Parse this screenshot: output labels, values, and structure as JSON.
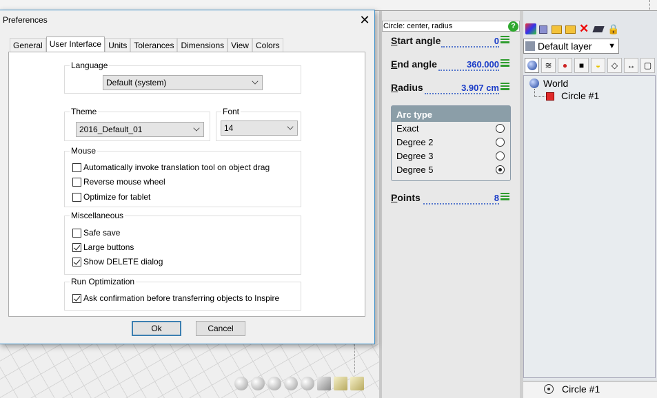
{
  "dialog": {
    "title": "Preferences",
    "tabs": [
      "General",
      "User Interface",
      "Units",
      "Tolerances",
      "Dimensions",
      "View",
      "Colors"
    ],
    "language": {
      "label": "Language",
      "value": "Default (system)"
    },
    "theme": {
      "label": "Theme",
      "value": "2016_Default_01"
    },
    "font": {
      "label": "Font",
      "value": "14"
    },
    "mouse": {
      "label": "Mouse",
      "options": [
        {
          "label": "Automatically invoke translation tool on object drag",
          "checked": false
        },
        {
          "label": "Reverse mouse wheel",
          "checked": false
        },
        {
          "label": "Optimize for tablet",
          "checked": false
        }
      ]
    },
    "misc": {
      "label": "Miscellaneous",
      "options": [
        {
          "label": "Safe save",
          "checked": false
        },
        {
          "label": "Large buttons",
          "checked": true
        },
        {
          "label": "Show DELETE dialog",
          "checked": true
        }
      ]
    },
    "runopt": {
      "label": "Run Optimization",
      "options": [
        {
          "label": "Ask confirmation before transferring objects to Inspire",
          "checked": true
        }
      ]
    },
    "ok": "Ok",
    "cancel": "Cancel"
  },
  "properties": {
    "command": "Circle: center, radius",
    "start_angle": {
      "label": "Start angle",
      "value": "0"
    },
    "end_angle": {
      "label": "End angle",
      "value": "360.000"
    },
    "radius": {
      "label": "Radius",
      "value": "3.907 cm"
    },
    "arc_type": {
      "label": "Arc type",
      "options": [
        {
          "label": "Exact",
          "selected": false
        },
        {
          "label": "Degree 2",
          "selected": false
        },
        {
          "label": "Degree 3",
          "selected": false
        },
        {
          "label": "Degree 5",
          "selected": true
        }
      ]
    },
    "points": {
      "label": "Points",
      "value": "8"
    }
  },
  "layers": {
    "current": "Default layer",
    "tree": {
      "root": "World",
      "child": "Circle #1"
    },
    "selected": "Circle #1"
  }
}
